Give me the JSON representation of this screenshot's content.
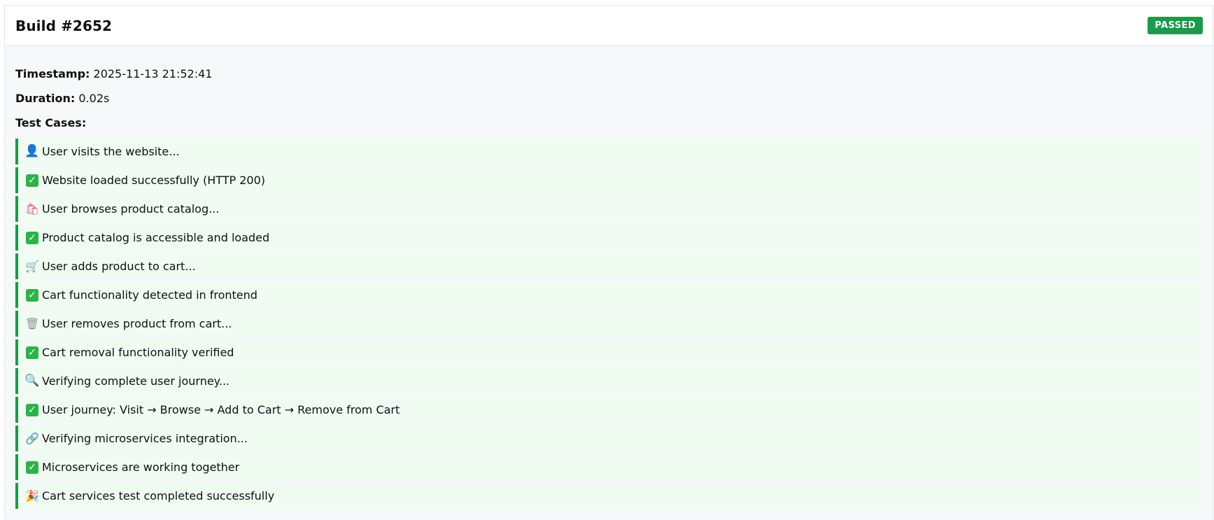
{
  "build": {
    "title": "Build #2652",
    "status": "PASSED",
    "status_color": "#1a9a4b"
  },
  "meta": {
    "timestamp_label": "Timestamp:",
    "timestamp_value": "2025-11-13 21:52:41",
    "duration_label": "Duration:",
    "duration_value": "0.02s",
    "test_cases_label": "Test Cases:"
  },
  "tests": [
    {
      "icon": "user-icon",
      "glyph": "👤",
      "text": "User visits the website..."
    },
    {
      "icon": "check-icon",
      "glyph": "✓",
      "text": "Website loaded successfully (HTTP 200)"
    },
    {
      "icon": "shopping-bag-icon",
      "glyph": "🛍",
      "text": "User browses product catalog..."
    },
    {
      "icon": "check-icon",
      "glyph": "✓",
      "text": "Product catalog is accessible and loaded"
    },
    {
      "icon": "cart-icon",
      "glyph": "🛒",
      "text": "User adds product to cart..."
    },
    {
      "icon": "check-icon",
      "glyph": "✓",
      "text": "Cart functionality detected in frontend"
    },
    {
      "icon": "trash-icon",
      "glyph": "🗑",
      "text": "User removes product from cart..."
    },
    {
      "icon": "check-icon",
      "glyph": "✓",
      "text": "Cart removal functionality verified"
    },
    {
      "icon": "magnifier-icon",
      "glyph": "🔍",
      "text": "Verifying complete user journey..."
    },
    {
      "icon": "check-icon",
      "glyph": "✓",
      "text": "User journey: Visit → Browse → Add to Cart → Remove from Cart"
    },
    {
      "icon": "link-icon",
      "glyph": "🔗",
      "text": "Verifying microservices integration..."
    },
    {
      "icon": "check-icon",
      "glyph": "✓",
      "text": "Microservices are working together"
    },
    {
      "icon": "party-popper-icon",
      "glyph": "🎉",
      "text": "Cart services test completed successfully"
    }
  ]
}
